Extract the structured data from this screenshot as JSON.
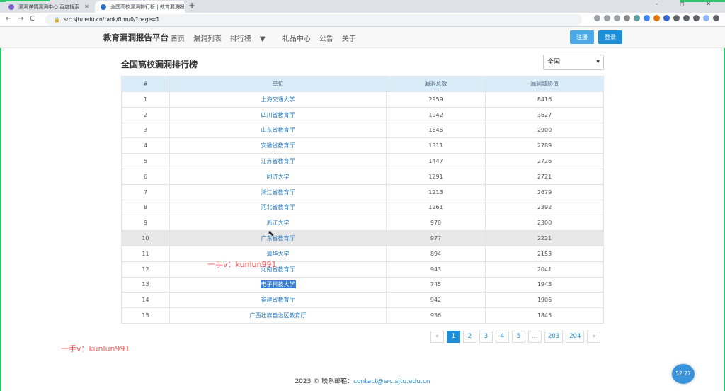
{
  "browser": {
    "tabs": [
      {
        "title": "漏洞详情漏洞中心 百度搜索",
        "favicon": "bug-favicon"
      },
      {
        "title": "全国高校漏洞排行榜 | 教育漏洞报",
        "favicon": "site-favicon"
      }
    ],
    "new_tab": "+",
    "window_controls": "– ◻ ✕",
    "url": "src.sjtu.edu.cn/rank/firm/0/?page=1",
    "nav": {
      "back": "←",
      "forward": "→",
      "reload": "C",
      "home": "⌂"
    }
  },
  "site": {
    "brand": "教育漏洞报告平台",
    "nav_items": [
      "首页",
      "漏洞列表",
      "排行榜",
      "礼品中心",
      "公告",
      "关于"
    ],
    "register": "注册",
    "login": "登录"
  },
  "page": {
    "title": "全国高校漏洞排行榜",
    "region_select": "全国"
  },
  "table": {
    "headers": [
      "#",
      "单位",
      "漏洞总数",
      "漏洞威胁值"
    ],
    "rows": [
      {
        "rank": "1",
        "unit": "上海交通大学",
        "total": "2959",
        "threat": "8416"
      },
      {
        "rank": "2",
        "unit": "四川省教育厅",
        "total": "1942",
        "threat": "3627"
      },
      {
        "rank": "3",
        "unit": "山东省教育厅",
        "total": "1645",
        "threat": "2900"
      },
      {
        "rank": "4",
        "unit": "安徽省教育厅",
        "total": "1311",
        "threat": "2789"
      },
      {
        "rank": "5",
        "unit": "江苏省教育厅",
        "total": "1447",
        "threat": "2726"
      },
      {
        "rank": "6",
        "unit": "同济大学",
        "total": "1291",
        "threat": "2721"
      },
      {
        "rank": "7",
        "unit": "浙江省教育厅",
        "total": "1213",
        "threat": "2679"
      },
      {
        "rank": "8",
        "unit": "河北省教育厅",
        "total": "1261",
        "threat": "2392"
      },
      {
        "rank": "9",
        "unit": "浙江大学",
        "total": "978",
        "threat": "2300"
      },
      {
        "rank": "10",
        "unit": "广东省教育厅",
        "total": "977",
        "threat": "2221"
      },
      {
        "rank": "11",
        "unit": "清华大学",
        "total": "894",
        "threat": "2153"
      },
      {
        "rank": "12",
        "unit": "河南省教育厅",
        "total": "943",
        "threat": "2041"
      },
      {
        "rank": "13",
        "unit": "电子科技大学",
        "total": "745",
        "threat": "1943"
      },
      {
        "rank": "14",
        "unit": "福建省教育厅",
        "total": "942",
        "threat": "1906"
      },
      {
        "rank": "15",
        "unit": "广西壮族自治区教育厅",
        "total": "936",
        "threat": "1845"
      }
    ]
  },
  "pagination": [
    "«",
    "1",
    "2",
    "3",
    "4",
    "5",
    "...",
    "203",
    "204",
    "»"
  ],
  "watermark": "一手v：kunlun991",
  "footer": {
    "text": "2023 © 联系邮箱：",
    "email": "contact@src.sjtu.edu.cn"
  },
  "clock": "52:27",
  "colors": {
    "accent": "#1e8ed6",
    "header_bg": "#d9ecf8",
    "link": "#2a7bc0",
    "watermark": "#f35a5a",
    "frame": "#2bc66b"
  }
}
